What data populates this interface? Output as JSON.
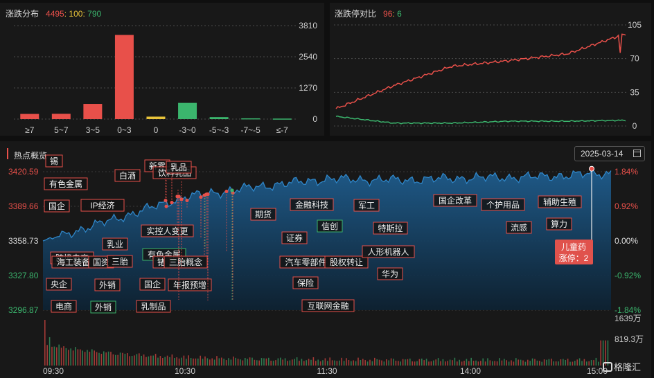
{
  "distribution": {
    "title": "涨跌分布",
    "up": "4495",
    "flat": "100",
    "down": "790",
    "y_ticks": [
      "3810",
      "2540",
      "1270",
      "0"
    ]
  },
  "limit_compare": {
    "title": "涨跌停对比",
    "limit_up": "96",
    "limit_down": "6",
    "y_ticks": [
      "105",
      "70",
      "35",
      "0"
    ]
  },
  "hotspot": {
    "title": "热点概览",
    "date": "2025-03-14",
    "price_ticks": [
      "3420.59",
      "3389.66",
      "3358.73",
      "3327.80",
      "3296.87"
    ],
    "pct_ticks": [
      "1.84%",
      "0.92%",
      "0.00%",
      "-0.92%",
      "-1.84%"
    ],
    "volume_ticks": [
      "1639万",
      "819.3万"
    ],
    "time_ticks": [
      "09:30",
      "10:30",
      "11:30",
      "14:00",
      "15:00"
    ],
    "callout": {
      "name": "儿童药",
      "detail": "涨停：2"
    },
    "tags": [
      {
        "text": "锡",
        "green": false
      },
      {
        "text": "有色金属",
        "green": false
      },
      {
        "text": "国企",
        "green": false
      },
      {
        "text": "IP经济",
        "green": false
      },
      {
        "text": "白酒",
        "green": false
      },
      {
        "text": "新零",
        "green": false
      },
      {
        "text": "饮料乳品",
        "green": false
      },
      {
        "text": "乳品",
        "green": false
      },
      {
        "text": "实控人变更",
        "green": false
      },
      {
        "text": "乳业",
        "green": false
      },
      {
        "text": "跨境电商",
        "green": false
      },
      {
        "text": "海工装备",
        "green": false
      },
      {
        "text": "国资",
        "green": false
      },
      {
        "text": "三胎",
        "green": false
      },
      {
        "text": "有色金属",
        "green": true
      },
      {
        "text": "锗",
        "green": false
      },
      {
        "text": "三胎概念",
        "green": false
      },
      {
        "text": "央企",
        "green": false
      },
      {
        "text": "外销",
        "green": false
      },
      {
        "text": "国企",
        "green": false
      },
      {
        "text": "年报预增",
        "green": false
      },
      {
        "text": "电商",
        "green": false
      },
      {
        "text": "外销",
        "green": true
      },
      {
        "text": "乳制品",
        "green": false
      },
      {
        "text": "期货",
        "green": false
      },
      {
        "text": "金融科技",
        "green": false
      },
      {
        "text": "信创",
        "green": true
      },
      {
        "text": "证券",
        "green": false
      },
      {
        "text": "汽车零部件",
        "green": false
      },
      {
        "text": "股权转让",
        "green": false
      },
      {
        "text": "保险",
        "green": false
      },
      {
        "text": "互联网金融",
        "green": false
      },
      {
        "text": "军工",
        "green": false
      },
      {
        "text": "特斯拉",
        "green": false
      },
      {
        "text": "人形机器人",
        "green": false
      },
      {
        "text": "华为",
        "green": false
      },
      {
        "text": "国企改革",
        "green": false
      },
      {
        "text": "个护用品",
        "green": false
      },
      {
        "text": "流感",
        "green": false
      },
      {
        "text": "辅助生殖",
        "green": false
      },
      {
        "text": "算力",
        "green": false
      }
    ]
  },
  "watermark": "格隆汇",
  "colors": {
    "up": "#e8504a",
    "flat": "#e8c33a",
    "down": "#3bb56d",
    "area": "#1f5d8e"
  },
  "chart_data": [
    {
      "type": "bar",
      "categories": [
        "≥7",
        "5~7",
        "3~5",
        "0~3",
        "0",
        "-3~0",
        "-5~-3",
        "-7~-5",
        "≤-7"
      ],
      "values": [
        210,
        215,
        620,
        3430,
        100,
        660,
        80,
        30,
        20
      ],
      "ylim": [
        0,
        3810
      ],
      "grid": true
    },
    {
      "type": "line",
      "x": [
        "09:30",
        "10:30",
        "11:30/13:00",
        "14:00",
        "15:00"
      ],
      "series": [
        {
          "values": [
            18,
            42,
            62,
            68,
            75,
            96
          ]
        },
        {
          "values": [
            10,
            3,
            3,
            5,
            5,
            6
          ]
        }
      ],
      "ylim": [
        0,
        105
      ],
      "grid": true
    },
    {
      "type": "area",
      "x": [
        "09:30",
        "10:00",
        "10:30",
        "11:00",
        "11:30",
        "13:30",
        "14:00",
        "14:30",
        "15:00"
      ],
      "series": [
        {
          "values": [
            3358.7,
            3378.0,
            3398.0,
            3407.0,
            3414.0,
            3413.0,
            3415.0,
            3416.0,
            3419.5
          ]
        }
      ],
      "ylim": [
        3296.87,
        3420.59
      ],
      "y2_pct": [
        -1.84,
        1.84
      ],
      "volume_max": 1639
    }
  ]
}
